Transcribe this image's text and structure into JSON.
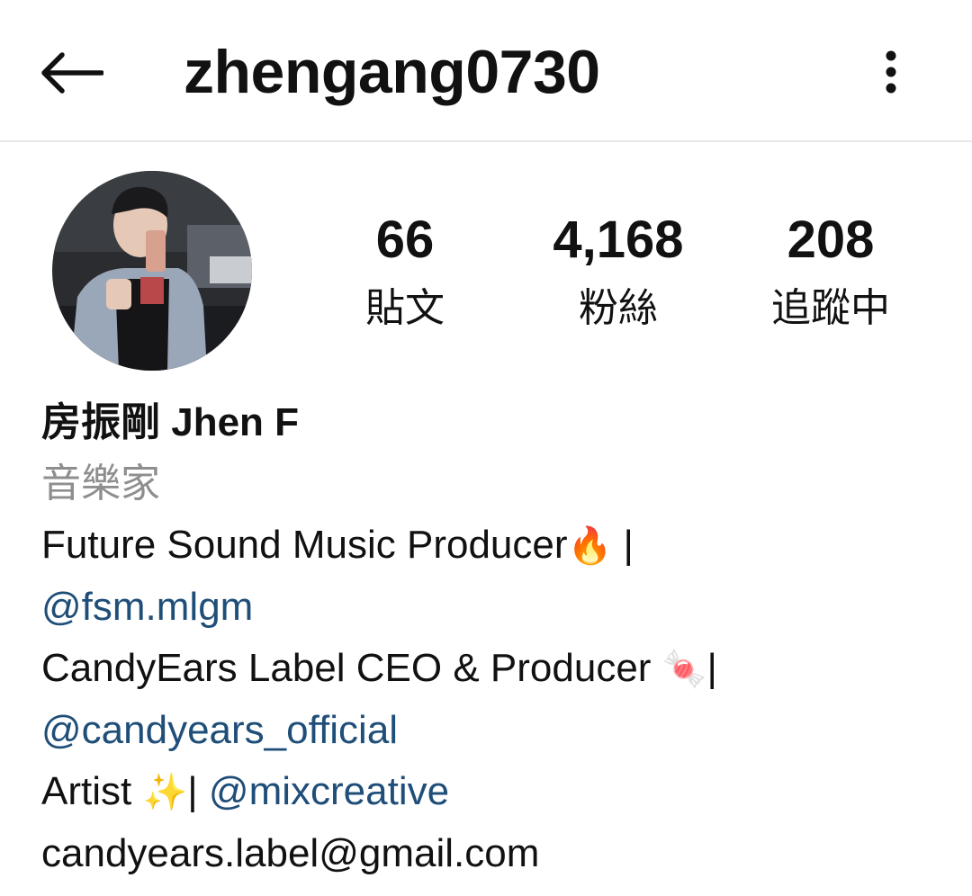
{
  "header": {
    "username": "zhengang0730",
    "back_icon": "arrow-left-icon",
    "more_icon": "more-vertical-icon"
  },
  "profile": {
    "avatar": "profile-photo",
    "stats": [
      {
        "value": "66",
        "label": "貼文"
      },
      {
        "value": "4,168",
        "label": "粉絲"
      },
      {
        "value": "208",
        "label": "追蹤中"
      }
    ]
  },
  "bio": {
    "display_name": "房振剛 Jhen F",
    "category": "音樂家",
    "line1_text": "Future Sound Music Producer",
    "line1_emoji": "🔥",
    "line1_sep": " |",
    "line2_mention": "@fsm.mlgm",
    "line3_text": "CandyEars Label CEO & Producer ",
    "line3_emoji": "🍬",
    "line3_sep": "|",
    "line4_mention": "@candyears_official",
    "line5_text": "Artist ",
    "line5_emoji": "✨",
    "line5_sep": "| ",
    "line5_mention": "@mixcreative",
    "email": "candyears.label@gmail.com"
  },
  "colors": {
    "mention": "#1f4e79",
    "category": "#8e8e8e",
    "divider": "#e6e6e6"
  }
}
